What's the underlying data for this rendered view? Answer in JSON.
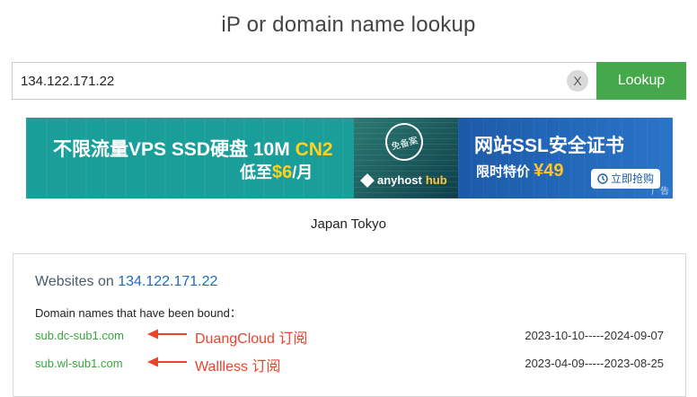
{
  "page": {
    "title": "iP or domain name lookup"
  },
  "search": {
    "value": "134.122.171.22",
    "clear_label": "X",
    "button_label": "Lookup"
  },
  "banner": {
    "line1_prefix": "不限流量VPS SSD硬盘 10M ",
    "line1_highlight": "CN2",
    "line2_prefix": "低至",
    "line2_price": "$6",
    "line2_suffix": "/月",
    "badge": "免备案",
    "brand_prefix": "anyhost",
    "brand_accent": "hub",
    "ssl_title": "网站SSL安全证书",
    "ssl_sub": "限时特价 ",
    "ssl_price": "¥49",
    "buy_label": "立即抢购",
    "ad_label": "广告"
  },
  "location": "Japan Tokyo",
  "websites": {
    "heading_prefix": "Websites on ",
    "heading_ip": "134.122.171.22",
    "bound_label": "Domain names that have been bound：",
    "rows": [
      {
        "domain": "sub.dc-sub1.com",
        "annotation": "DuangCloud 订阅",
        "dates": "2023-10-10-----2024-09-07"
      },
      {
        "domain": "sub.wl-sub1.com",
        "annotation": "Wallless 订阅",
        "dates": "2023-04-09-----2023-08-25"
      }
    ]
  },
  "colors": {
    "lookup_green": "#45a84b",
    "domain_green": "#3aa53f",
    "annotation_red": "#e8452c",
    "link_blue": "#1e6bb8"
  },
  "icons": {
    "clear": "close-icon",
    "arrow": "arrow-left-icon",
    "buy": "clock-icon"
  }
}
